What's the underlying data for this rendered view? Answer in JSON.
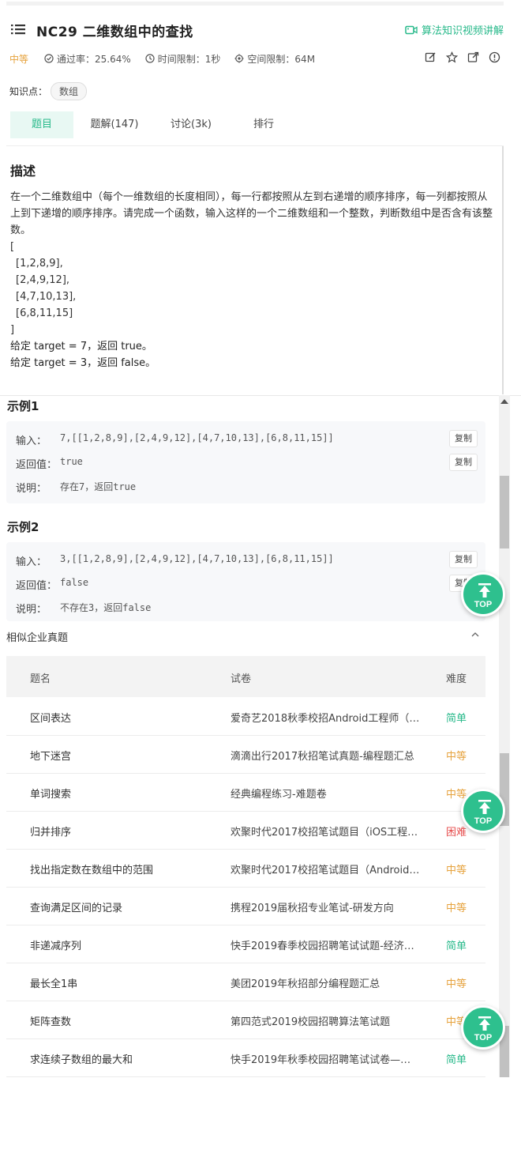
{
  "header": {
    "title": "NC29  二维数组中的查找",
    "video_link": "算法知识视频讲解"
  },
  "meta": {
    "difficulty": "中等",
    "pass_rate": "通过率：25.64%",
    "time_limit": "时间限制：1秒",
    "space_limit": "空间限制：64M"
  },
  "knowledge": {
    "label": "知识点：",
    "tag": "数组"
  },
  "tabs": [
    {
      "label": "题目"
    },
    {
      "label": "题解(147)"
    },
    {
      "label": "讨论(3k)"
    },
    {
      "label": "排行"
    }
  ],
  "description": {
    "heading": "描述",
    "text": "在一个二维数组中（每个一维数组的长度相同），每一行都按照从左到右递增的顺序排序，每一列都按照从上到下递增的顺序排序。请完成一个函数，输入这样的一个二维数组和一个整数，判断数组中是否含有该整数。",
    "lines": [
      "[",
      "  [1,2,8,9],",
      "  [2,4,9,12],",
      "  [4,7,10,13],",
      "  [6,8,11,15]",
      "]"
    ],
    "given1": "给定 target = 7，返回 true。",
    "given2": "给定 target = 3，返回 false。"
  },
  "examples": [
    {
      "title": "示例1",
      "input_label": "输入：",
      "input": "7,[[1,2,8,9],[2,4,9,12],[4,7,10,13],[6,8,11,15]]",
      "return_label": "返回值：",
      "return": "true",
      "note_label": "说明：",
      "note": "存在7，返回true",
      "copy": "复制"
    },
    {
      "title": "示例2",
      "input_label": "输入：",
      "input": "3,[[1,2,8,9],[2,4,9,12],[4,7,10,13],[6,8,11,15]]",
      "return_label": "返回值：",
      "return": "false",
      "note_label": "说明：",
      "note": "不存在3，返回false",
      "copy": "复制"
    }
  ],
  "similar": {
    "heading": "相似企业真题",
    "columns": [
      "题名",
      "试卷",
      "难度"
    ],
    "rows": [
      {
        "name": "区间表达",
        "paper": "爱奇艺2018秋季校招Android工程师（…",
        "level": "简单",
        "cls": "easy"
      },
      {
        "name": "地下迷宫",
        "paper": "滴滴出行2017秋招笔试真题-编程题汇总",
        "level": "中等",
        "cls": "mid"
      },
      {
        "name": "单词搜索",
        "paper": "经典编程练习-难题卷",
        "level": "中等",
        "cls": "mid"
      },
      {
        "name": "归并排序",
        "paper": "欢聚时代2017校招笔试题目（iOS工程…",
        "level": "困难",
        "cls": "hard"
      },
      {
        "name": "找出指定数在数组中的范围",
        "paper": "欢聚时代2017校招笔试题目（Android…",
        "level": "中等",
        "cls": "mid"
      },
      {
        "name": "查询满足区间的记录",
        "paper": "携程2019届秋招专业笔试-研发方向",
        "level": "中等",
        "cls": "mid"
      },
      {
        "name": "非递减序列",
        "paper": "快手2019春季校园招聘笔试试题-经济…",
        "level": "简单",
        "cls": "easy"
      },
      {
        "name": "最长全1串",
        "paper": "美团2019年秋招部分编程题汇总",
        "level": "中等",
        "cls": "mid"
      },
      {
        "name": "矩阵查数",
        "paper": "第四范式2019校园招聘算法笔试题",
        "level": "中等",
        "cls": "mid"
      },
      {
        "name": "求连续子数组的最大和",
        "paper": "快手2019年秋季校园招聘笔试试卷—…",
        "level": "简单",
        "cls": "easy"
      }
    ]
  },
  "top_button": "TOP",
  "colors": {
    "accent": "#27b98a",
    "medium": "#e6a23c",
    "hard": "#e64b4b"
  }
}
